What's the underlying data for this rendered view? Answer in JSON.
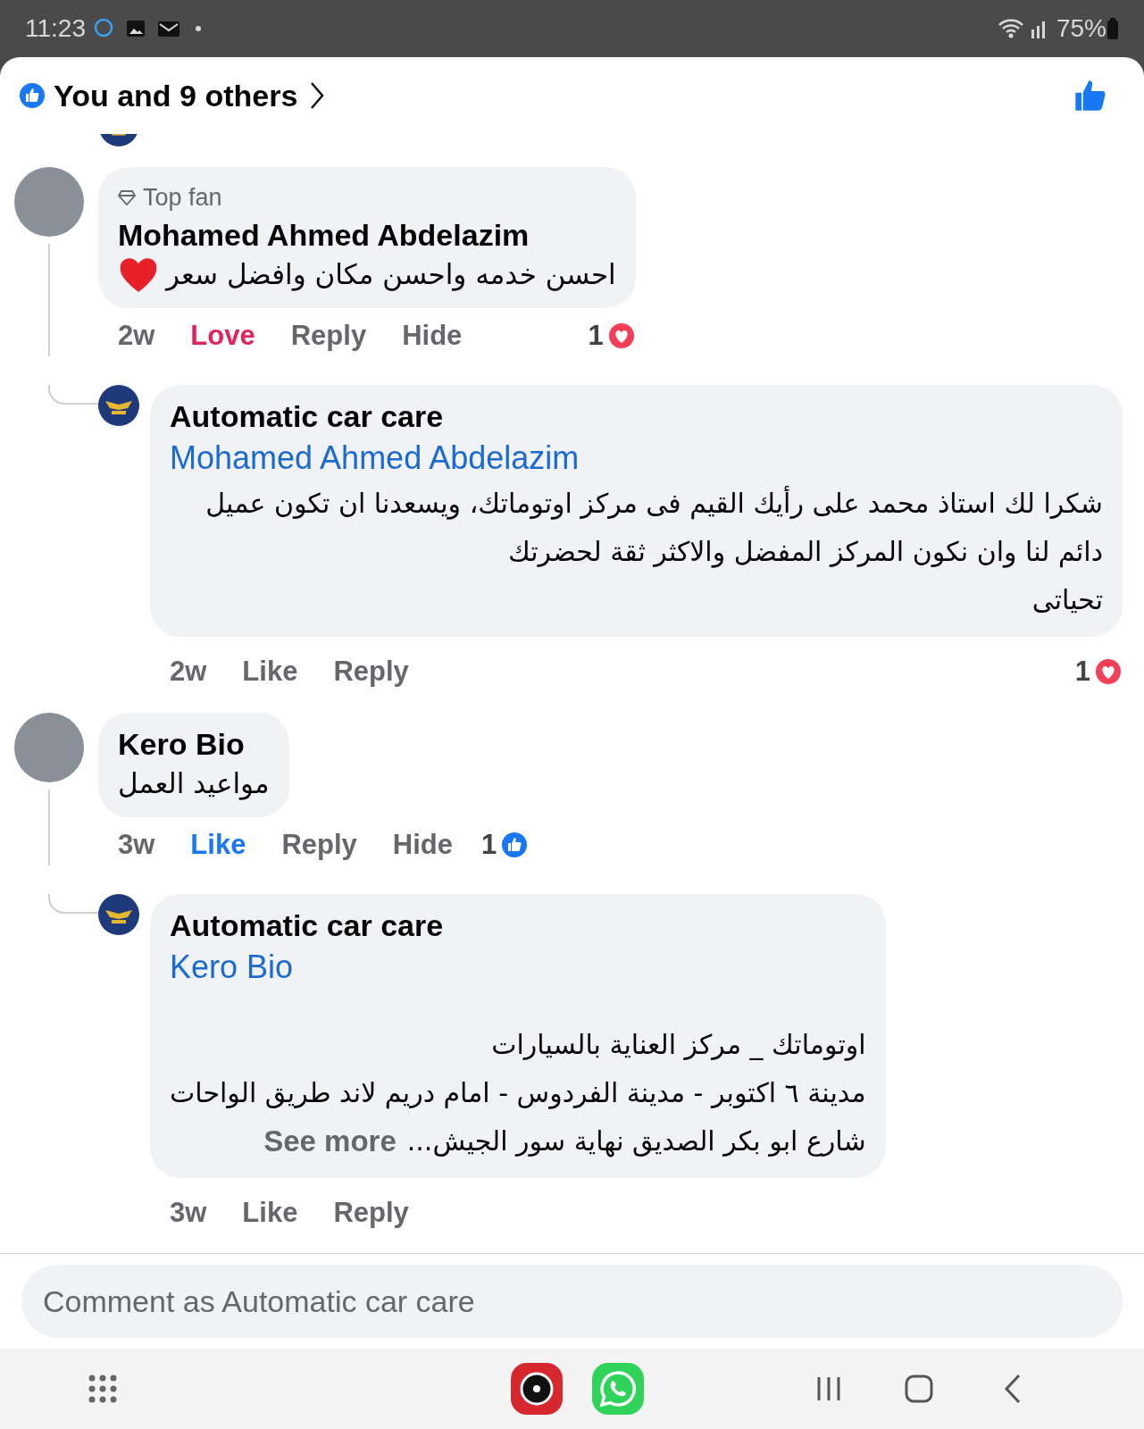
{
  "status_bar": {
    "time": "11:23",
    "battery": "75%"
  },
  "header": {
    "title": "You and 9 others"
  },
  "threads": [
    {
      "comment": {
        "badge": "Top fan",
        "author": "Mohamed Ahmed Abdelazim",
        "lines": [
          "احسن خدمه واحسن مكان وافضل سعر"
        ],
        "heart_emoji": true,
        "time": "2w",
        "react": {
          "label": "Love",
          "kind": "love"
        },
        "actions": [
          "Reply",
          "Hide"
        ],
        "reactions": {
          "count": "1",
          "kind": "love"
        }
      },
      "reply": {
        "author": "Automatic car care",
        "mention": "Mohamed Ahmed Abdelazim",
        "spaced": false,
        "lines": [
          "شكرا لك استاذ محمد على رأيك القيم فى مركز اوتوماتك،  ويسعدنا ان تكون عميل دائم لنا وان نكون المركز المفضل والاكثر ثقة لحضرتك",
          "تحياتى"
        ],
        "time": "2w",
        "react": {
          "label": "Like",
          "kind": "none"
        },
        "actions": [
          "Reply"
        ],
        "reactions": {
          "count": "1",
          "kind": "love"
        }
      }
    },
    {
      "comment": {
        "author": "Kero Bio",
        "lines": [
          "مواعيد العمل"
        ],
        "heart_emoji": false,
        "time": "3w",
        "react": {
          "label": "Like",
          "kind": "like"
        },
        "actions": [
          "Reply",
          "Hide"
        ],
        "reactions": {
          "count": "1",
          "kind": "like"
        }
      },
      "reply": {
        "author": "Automatic car care",
        "mention": "Kero Bio",
        "spaced": true,
        "lines": [
          "اوتوماتك _ مركز العناية بالسيارات",
          "مدينة ٦ اكتوبر - مدينة الفردوس -  امام دريم لاند طريق الواحات",
          "شارع ابو بكر الصديق نهاية سور الجيش..."
        ],
        "see_more": "See more",
        "time": "3w",
        "react": {
          "label": "Like",
          "kind": "none"
        },
        "actions": [
          "Reply"
        ]
      }
    }
  ],
  "composer": {
    "placeholder": "Comment as Automatic car care"
  }
}
